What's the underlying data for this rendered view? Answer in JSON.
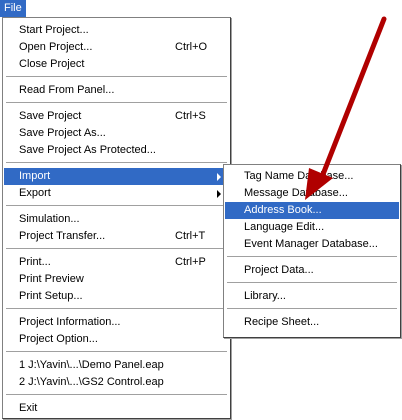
{
  "menubar": {
    "file_label": "File"
  },
  "file_menu": {
    "start_project": "Start Project...",
    "open_project": "Open Project...",
    "open_project_shortcut": "Ctrl+O",
    "close_project": "Close Project",
    "read_from_panel": "Read From Panel...",
    "save_project": "Save Project",
    "save_project_shortcut": "Ctrl+S",
    "save_project_as": "Save Project As...",
    "save_project_as_protected": "Save Project As Protected...",
    "import": "Import",
    "export": "Export",
    "simulation": "Simulation...",
    "project_transfer": "Project Transfer...",
    "project_transfer_shortcut": "Ctrl+T",
    "print": "Print...",
    "print_shortcut": "Ctrl+P",
    "print_preview": "Print Preview",
    "print_setup": "Print Setup...",
    "project_information": "Project Information...",
    "project_option": "Project Option...",
    "recent_1": "1 J:\\Yavin\\...\\Demo Panel.eap",
    "recent_2": "2 J:\\Yavin\\...\\GS2 Control.eap",
    "exit": "Exit"
  },
  "import_submenu": {
    "tag_name_database": "Tag Name Database...",
    "message_database": "Message Database...",
    "address_book": "Address Book...",
    "language_edit": "Language Edit...",
    "event_manager_database": "Event Manager Database...",
    "project_data": "Project Data...",
    "library": "Library...",
    "recipe_sheet": "Recipe Sheet..."
  },
  "colors": {
    "highlight": "#316ac5",
    "arrow": "#c00000"
  },
  "annotation": {
    "icon": "red-arrow-pointer"
  }
}
